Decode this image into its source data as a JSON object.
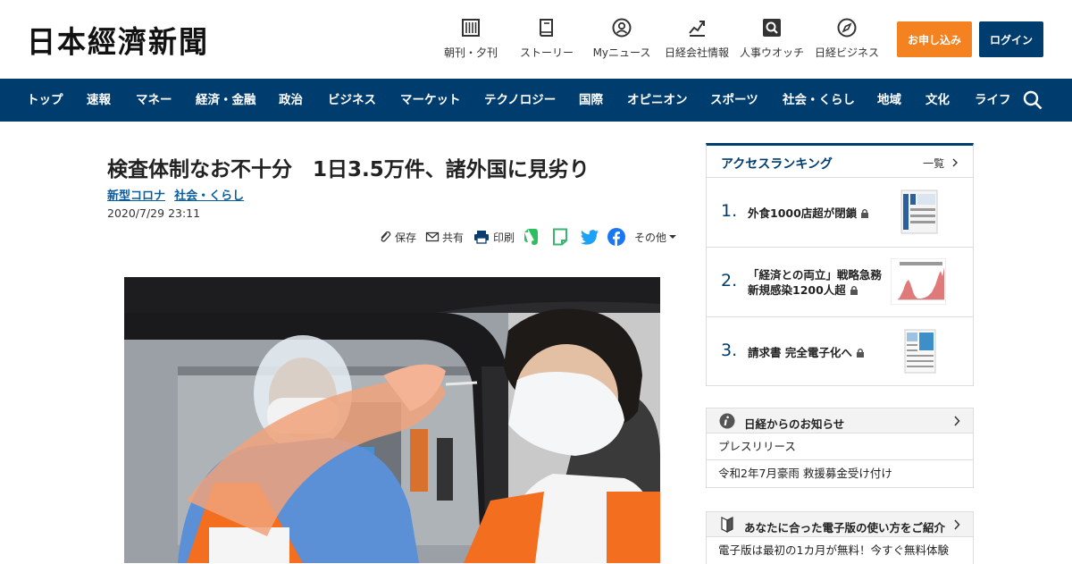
{
  "header": {
    "logo": "日本經濟新聞",
    "utility": [
      {
        "label": "朝刊・夕刊",
        "icon": "newspaper-icon"
      },
      {
        "label": "ストーリー",
        "icon": "book-icon"
      },
      {
        "label": "Myニュース",
        "icon": "person-icon"
      },
      {
        "label": "日経会社情報",
        "icon": "chart-icon"
      },
      {
        "label": "人事ウオッチ",
        "icon": "magnifier-icon"
      },
      {
        "label": "日経ビジネス",
        "icon": "compass-icon"
      }
    ],
    "apply_label": "お申し込み",
    "login_label": "ログイン"
  },
  "nav": {
    "items": [
      "トップ",
      "速報",
      "マネー",
      "経済・金融",
      "政治",
      "ビジネス",
      "マーケット",
      "テクノロジー",
      "国際",
      "オピニオン",
      "スポーツ",
      "社会・くらし",
      "地域",
      "文化",
      "ライフ"
    ]
  },
  "article": {
    "title": "検査体制なお不十分　1日3.5万件、諸外国に見劣り",
    "tags": [
      "新型コロナ",
      "社会・くらし"
    ],
    "date": "2020/7/29 23:11",
    "share": {
      "save": "保存",
      "share": "共有",
      "print": "印刷",
      "more": "その他"
    }
  },
  "ranking": {
    "title": "アクセスランキング",
    "more": "一覧",
    "items": [
      {
        "rank": "1.",
        "title": "外食1000店超が閉鎖"
      },
      {
        "rank": "2.",
        "title": "「経済との両立」戦略急務　新規感染1200人超"
      },
      {
        "rank": "3.",
        "title": "請求書 完全電子化へ"
      }
    ]
  },
  "notice": {
    "title": "日経からのお知らせ",
    "items": [
      "プレスリリース",
      "令和2年7月豪雨 救援募金受け付け"
    ]
  },
  "guide": {
    "title": "あなたに合った電子版の使い方をご紹介",
    "items": [
      "電子版は最初の1カ月が無料！今すぐ無料体験"
    ]
  },
  "colors": {
    "brand": "#003d6f",
    "accent": "#f58220",
    "link": "#0a5c9e"
  }
}
